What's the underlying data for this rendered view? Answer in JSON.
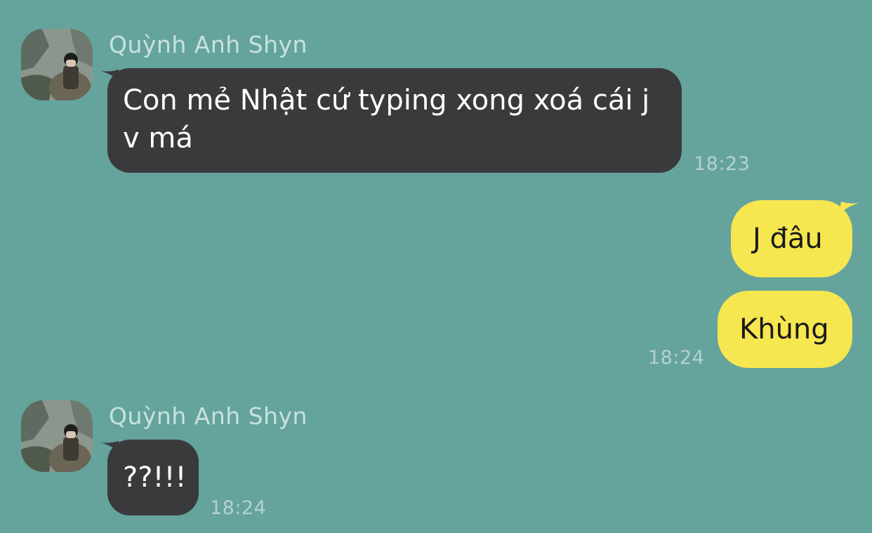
{
  "chat": {
    "colors": {
      "background": "#65a39d",
      "incoming_bubble": "#3a3a3d",
      "outgoing_bubble": "#f6e650",
      "sender_name": "#c7e2de",
      "timestamp": "#b3d3cf"
    },
    "groups": [
      {
        "direction": "incoming",
        "sender": "Quỳnh Anh Shyn",
        "avatar": "profile-photo",
        "messages": [
          {
            "text": "Con mẻ Nhật cứ typing xong xoá cái j v má"
          }
        ],
        "time": "18:23"
      },
      {
        "direction": "outgoing",
        "messages": [
          {
            "text": "J đâu"
          },
          {
            "text": "Khùng"
          }
        ],
        "time": "18:24"
      },
      {
        "direction": "incoming",
        "sender": "Quỳnh Anh Shyn",
        "avatar": "profile-photo",
        "messages": [
          {
            "text": "??!!!"
          }
        ],
        "time": "18:24"
      }
    ]
  }
}
